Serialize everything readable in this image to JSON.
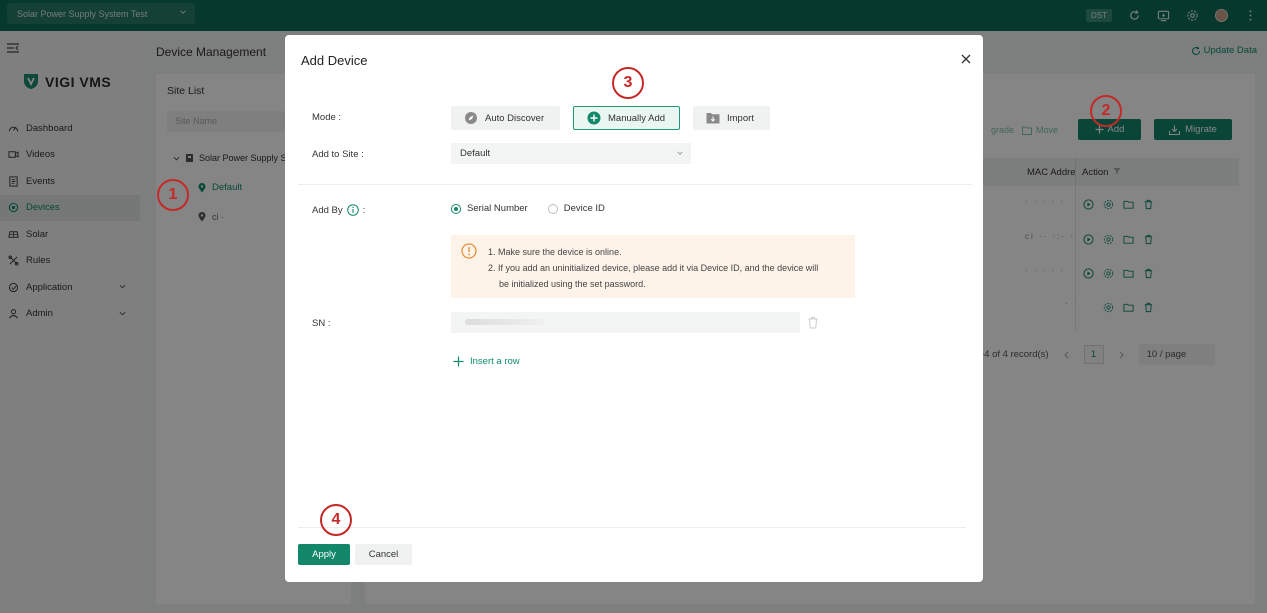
{
  "topbar": {
    "system_name": "Solar Power Supply System Test",
    "dst_label": "DST"
  },
  "sidebar": {
    "logo_text": "VIGI VMS",
    "items": [
      {
        "label": "Dashboard",
        "icon": "dashboard-icon"
      },
      {
        "label": "Videos",
        "icon": "video-icon"
      },
      {
        "label": "Events",
        "icon": "events-icon"
      },
      {
        "label": "Devices",
        "icon": "devices-icon",
        "active": true
      },
      {
        "label": "Solar",
        "icon": "solar-icon"
      },
      {
        "label": "Rules",
        "icon": "rules-icon"
      },
      {
        "label": "Application",
        "icon": "application-icon",
        "has_children": true
      },
      {
        "label": "Admin",
        "icon": "admin-icon",
        "has_children": true
      }
    ]
  },
  "main": {
    "title": "Device Management",
    "update_data": "Update Data",
    "site_list": {
      "title": "Site List",
      "search_placeholder": "Site Name",
      "root": "Solar Power Supply S",
      "default": "Default",
      "other": "ci ·"
    },
    "toolbar": {
      "upgrade": "grade",
      "move": "Move",
      "add": "Add",
      "migrate": "Migrate"
    },
    "table": {
      "col_mac": "MAC Addre",
      "col_action": "Action",
      "mac_values": [
        "·  · · · ·",
        "ci ·· ·:· ·",
        "·  · · · ·",
        "· ·"
      ]
    },
    "pagination": {
      "summary": "-4 of 4 record(s)",
      "current_page": "1",
      "page_size": "10 / page"
    }
  },
  "modal": {
    "title": "Add Device",
    "mode_label": "Mode :",
    "modes": [
      "Auto Discover",
      "Manually Add",
      "Import"
    ],
    "selected_mode": "Manually Add",
    "site_label": "Add to Site :",
    "site_value": "Default",
    "add_by_label": "Add By",
    "add_by_colon": ":",
    "add_by_options": [
      "Serial Number",
      "Device ID"
    ],
    "notice_lines": [
      "1. Make sure the device is online.",
      "2. If you add an uninitialized device, please add it via Device ID, and the device will",
      "be initialized using the set password."
    ],
    "sn_label": "SN :",
    "insert_row": "Insert a row",
    "apply": "Apply",
    "cancel": "Cancel"
  },
  "steps": [
    "1",
    "2",
    "3",
    "4"
  ],
  "colors": {
    "brand": "#0d6b56",
    "accent": "#12876a",
    "step_marker": "#c62828"
  }
}
